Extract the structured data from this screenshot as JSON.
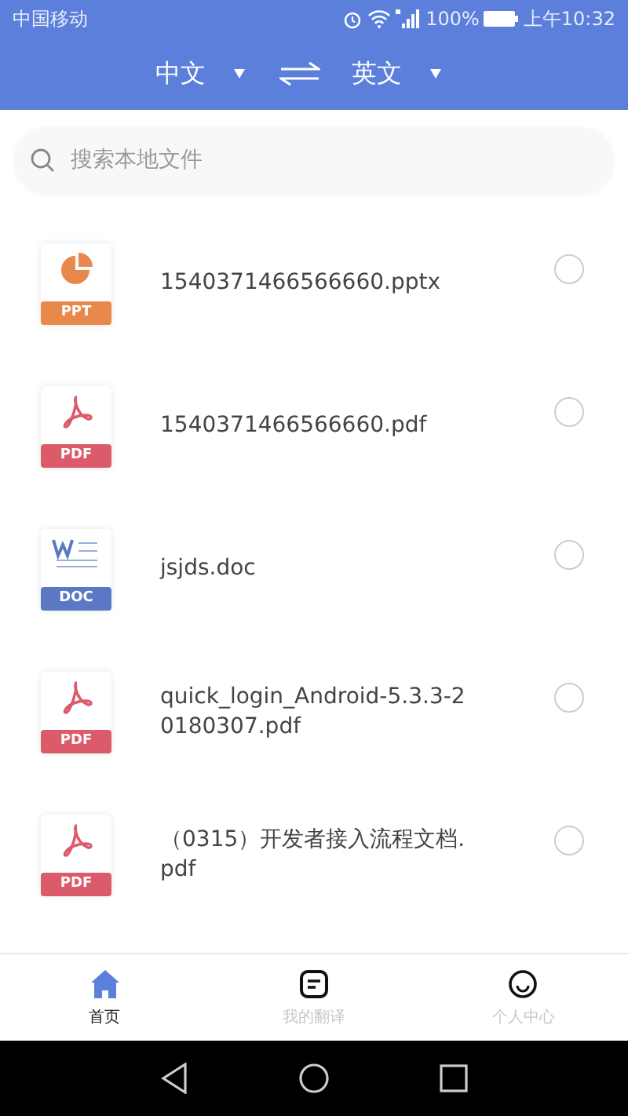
{
  "status_bar": {
    "carrier": "中国移动",
    "battery": "100%",
    "time": "上午10:32"
  },
  "header": {
    "source_lang": "中文",
    "target_lang": "英文"
  },
  "search": {
    "placeholder": "搜索本地文件"
  },
  "files": [
    {
      "kind": "ppt",
      "tag": "PPT",
      "name": "1540371466566660.pptx",
      "selected": false
    },
    {
      "kind": "pdf",
      "tag": "PDF",
      "name": "1540371466566660.pdf",
      "selected": false
    },
    {
      "kind": "doc",
      "tag": "DOC",
      "name": "jsjds.doc",
      "selected": false
    },
    {
      "kind": "pdf",
      "tag": "PDF",
      "name": "quick_login_Android-5.3.3-20180307.pdf",
      "selected": false
    },
    {
      "kind": "pdf",
      "tag": "PDF",
      "name": "（0315）开发者接入流程文档.pdf",
      "selected": false
    }
  ],
  "tabs": [
    {
      "kind": "home",
      "label": "首页",
      "selected": true
    },
    {
      "kind": "translations",
      "label": "我的翻译",
      "selected": false
    },
    {
      "kind": "profile",
      "label": "个人中心",
      "selected": false
    }
  ]
}
